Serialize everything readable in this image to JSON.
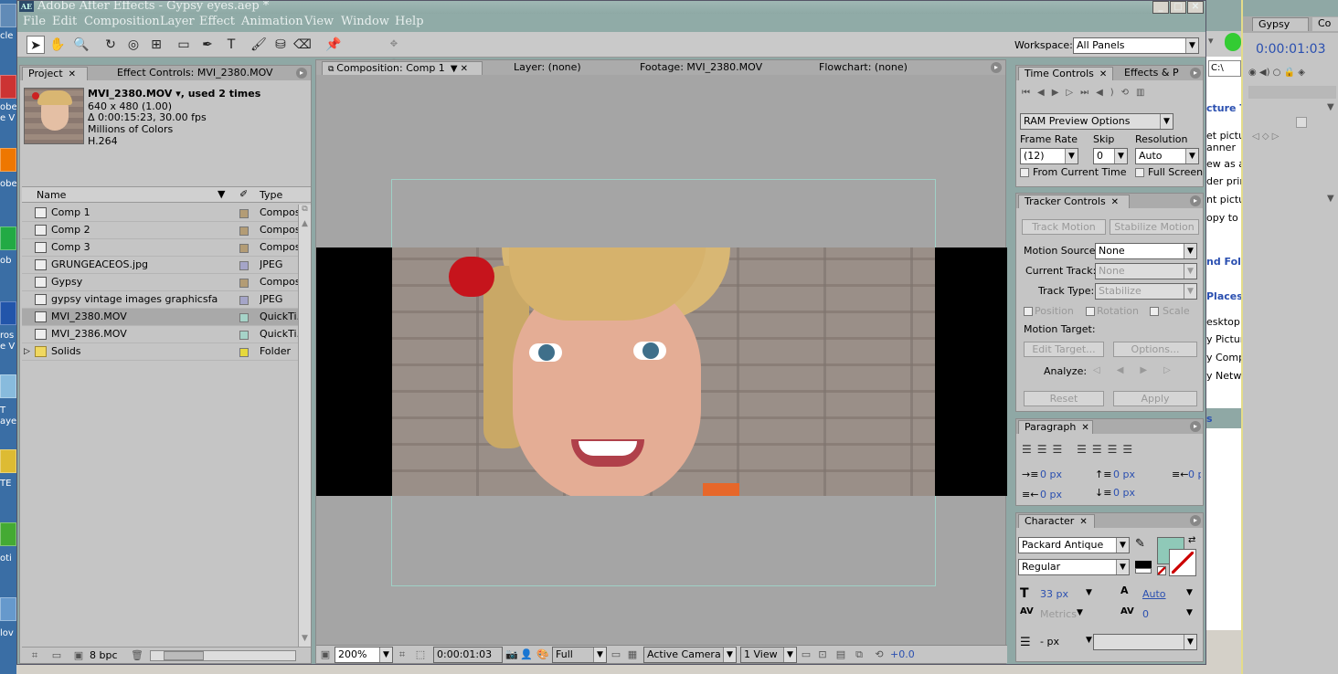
{
  "desktop": {
    "labels": [
      "cle",
      "obe A",
      "e V",
      "obe",
      "ob",
      "ros",
      "e V",
      "T",
      "aye",
      "TE",
      "oti",
      "lov"
    ]
  },
  "app": {
    "title": "Adobe After Effects - Gypsy eyes.aep *",
    "icon": "AE",
    "window_buttons": [
      "_",
      "□",
      "✕"
    ]
  },
  "menu": [
    "File",
    "Edit",
    "Composition",
    "Layer",
    "Effect",
    "Animation",
    "View",
    "Window",
    "Help"
  ],
  "toolbar": {
    "workspace_label": "Workspace:",
    "workspace_value": "All Panels"
  },
  "project": {
    "tabs": [
      "Project",
      "Effect Controls: MVI_2380.MOV"
    ],
    "item_name": "MVI_2380.MOV ▾, used 2 times",
    "item_info": [
      "640 x 480 (1.00)",
      "Δ 0:00:15:23, 30.00 fps",
      "Millions of Colors",
      "H.264"
    ],
    "col_name": "Name",
    "col_type": "Type",
    "items": [
      {
        "name": "Comp 1",
        "type": "Composi",
        "color": "#b39c75"
      },
      {
        "name": "Comp 2",
        "type": "Composi",
        "color": "#b39c75"
      },
      {
        "name": "Comp 3",
        "type": "Composi",
        "color": "#b39c75"
      },
      {
        "name": "GRUNGEACEOS.jpg",
        "type": "JPEG",
        "color": "#a5a5c8"
      },
      {
        "name": "Gypsy",
        "type": "Composi",
        "color": "#b39c75"
      },
      {
        "name": "gypsy vintage images graphicsfa",
        "type": "JPEG",
        "color": "#a5a5c8"
      },
      {
        "name": "MVI_2380.MOV",
        "type": "QuickTi...",
        "color": "#a6d3c8"
      },
      {
        "name": "MVI_2386.MOV",
        "type": "QuickTi...",
        "color": "#a6d3c8"
      },
      {
        "name": "Solids",
        "type": "Folder",
        "color": "#e6d83c"
      }
    ],
    "bpc": "8 bpc"
  },
  "viewer": {
    "tabs": [
      "Composition: Comp 1",
      "Layer: (none)",
      "Footage: MVI_2380.MOV",
      "Flowchart: (none)"
    ],
    "zoom": "200%",
    "timecode": "0:00:01:03",
    "resolution": "Full",
    "camera": "Active Camera",
    "views": "1 View",
    "exposure": "+0.0"
  },
  "time_controls": {
    "tabs": [
      "Time Controls",
      "Effects & P"
    ],
    "ram_preview": "RAM Preview Options",
    "frame_rate_label": "Frame Rate",
    "skip_label": "Skip",
    "resolution_label": "Resolution",
    "frame_rate": "(12)",
    "skip": "0",
    "resolution": "Auto",
    "from_current": "From Current Time",
    "full_screen": "Full Screen"
  },
  "tracker": {
    "title": "Tracker Controls",
    "track_motion": "Track Motion",
    "stabilize_motion": "Stabilize Motion",
    "motion_source_label": "Motion Source:",
    "motion_source": "None",
    "current_track_label": "Current Track:",
    "current_track": "None",
    "track_type_label": "Track Type:",
    "track_type": "Stabilize",
    "position": "Position",
    "rotation": "Rotation",
    "scale": "Scale",
    "motion_target": "Motion Target:",
    "edit_target": "Edit Target...",
    "options": "Options...",
    "analyze": "Analyze:",
    "reset": "Reset",
    "apply": "Apply"
  },
  "paragraph": {
    "title": "Paragraph",
    "values": [
      "0 px",
      "0 px",
      "0 px",
      "0 px",
      "0 px"
    ]
  },
  "character": {
    "title": "Character",
    "font": "Packard Antique",
    "style": "Regular",
    "size": "33 px",
    "leading": "Auto",
    "kerning": "Metrics",
    "tracking": "0",
    "stroke": "- px",
    "fill_color": "#8fc9b8"
  },
  "right_window": {
    "lines": [
      "cture T",
      "et pictur",
      "anner",
      "ew as a",
      "der prin",
      "nt pictu",
      "opy to C",
      "nd Fold",
      "Places",
      "esktop",
      "y Picture",
      "y Compu",
      "y Netwo",
      "s"
    ],
    "path": "C:\\"
  },
  "far_right": {
    "tabs": [
      "Gypsy",
      "Co"
    ],
    "timecode": "0:00:01:03"
  }
}
